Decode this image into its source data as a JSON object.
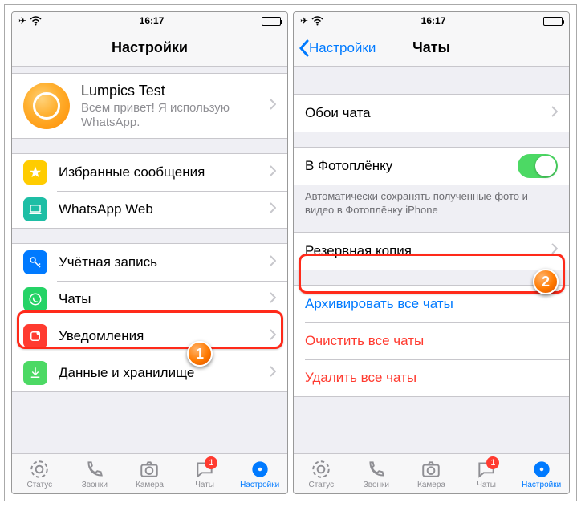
{
  "status": {
    "time": "16:17"
  },
  "left": {
    "title": "Настройки",
    "profile": {
      "name": "Lumpics Test",
      "subtitle": "Всем привет! Я использую WhatsApp."
    },
    "starred": "Избранные сообщения",
    "web": "WhatsApp Web",
    "account": "Учётная запись",
    "chats": "Чаты",
    "notifications": "Уведомления",
    "storage": "Данные и хранилище"
  },
  "right": {
    "back": "Настройки",
    "title": "Чаты",
    "wallpaper": "Обои чата",
    "camera_roll": "В Фотоплёнку",
    "camera_note": "Автоматически сохранять полученные фото и видео в Фотоплёнку iPhone",
    "backup": "Резервная копия",
    "archive": "Архивировать все чаты",
    "clear": "Очистить все чаты",
    "delete": "Удалить все чаты"
  },
  "tabs": {
    "status": "Статус",
    "calls": "Звонки",
    "camera": "Камера",
    "chats": "Чаты",
    "settings": "Настройки",
    "chats_badge": "1"
  },
  "annotations": {
    "step1": "1",
    "step2": "2"
  },
  "colors": {
    "yellow": "#ffcc00",
    "teal": "#1ebea5",
    "blue": "#007AFF",
    "red": "#ff3b30",
    "green": "#4cd964",
    "darkred": "#c93428",
    "whatsapp": "#25D366"
  }
}
